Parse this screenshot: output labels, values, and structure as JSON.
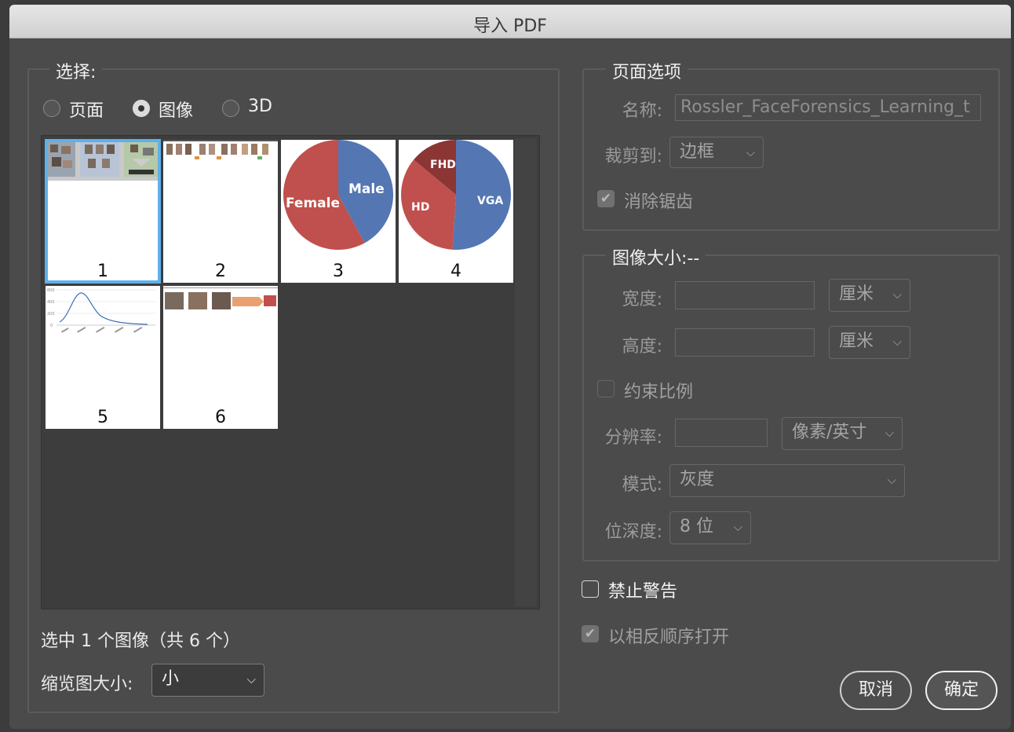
{
  "window": {
    "title": "导入 PDF"
  },
  "select_group": {
    "label": "选择:",
    "options": [
      {
        "label": "页面",
        "checked": false
      },
      {
        "label": "图像",
        "checked": true
      },
      {
        "label": "3D",
        "checked": false
      }
    ]
  },
  "thumbnails": [
    {
      "number": "1",
      "selected": true
    },
    {
      "number": "2",
      "selected": false
    },
    {
      "number": "3",
      "selected": false,
      "chart_data": {
        "type": "pie",
        "categories": [
          "Male",
          "Female"
        ],
        "values": [
          42,
          58
        ],
        "colors": [
          "#5476b3",
          "#c0504d"
        ]
      }
    },
    {
      "number": "4",
      "selected": false,
      "chart_data": {
        "type": "pie",
        "categories": [
          "VGA",
          "HD",
          "FHD"
        ],
        "values": [
          51,
          35,
          14
        ],
        "colors": [
          "#5476b3",
          "#c0504d",
          "#8b3535"
        ]
      }
    },
    {
      "number": "5",
      "selected": false,
      "chart_axis_labels": [
        "600",
        "400",
        "200",
        "0"
      ]
    },
    {
      "number": "6",
      "selected": false
    }
  ],
  "status": {
    "selected_text": "选中 1 个图像（共 6 个）"
  },
  "thumb_size": {
    "label": "缩览图大小:",
    "value": "小"
  },
  "page_options": {
    "label": "页面选项",
    "name_label": "名称:",
    "name_value": "Rossler_FaceForensics_Learning_t",
    "crop_label": "裁剪到:",
    "crop_value": "边框",
    "antialias_label": "消除锯齿",
    "antialias_checked": true
  },
  "image_size": {
    "label": "图像大小:--",
    "width_label": "宽度:",
    "width_value": "",
    "width_unit": "厘米",
    "height_label": "高度:",
    "height_value": "",
    "height_unit": "厘米",
    "constrain_label": "约束比例",
    "constrain_checked": false,
    "resolution_label": "分辨率:",
    "resolution_value": "",
    "resolution_unit": "像素/英寸",
    "mode_label": "模式:",
    "mode_value": "灰度",
    "depth_label": "位深度:",
    "depth_value": "8 位"
  },
  "suppress_warnings": {
    "label": "禁止警告",
    "checked": false
  },
  "reverse_order": {
    "label": "以相反顺序打开",
    "checked": true
  },
  "buttons": {
    "cancel": "取消",
    "ok": "确定"
  }
}
